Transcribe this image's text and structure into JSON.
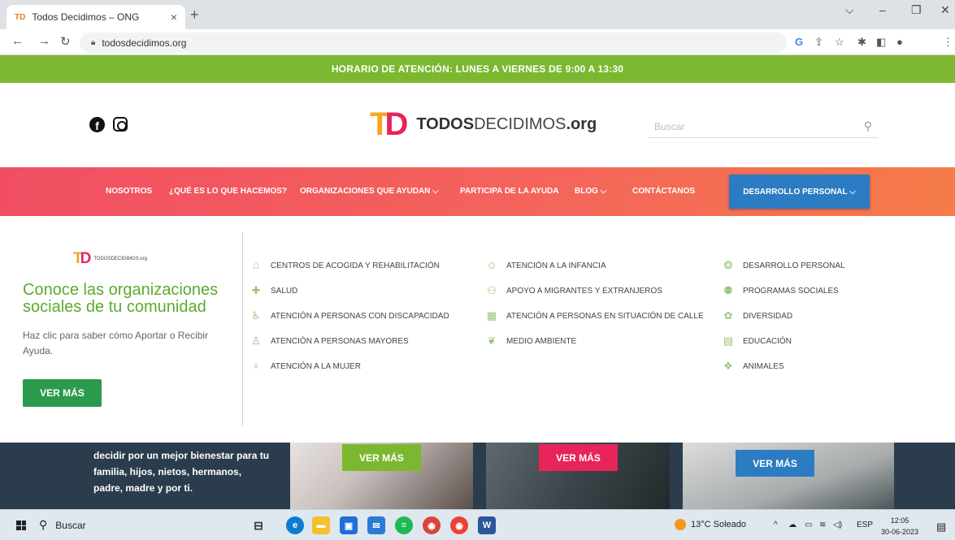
{
  "browser": {
    "tab_title": "Todos Decidimos – ONG",
    "tab_favicon": "TD",
    "url": "todosdecidimos.org",
    "nav_icons": [
      "back-icon",
      "forward-icon",
      "reload-icon"
    ]
  },
  "site": {
    "hours_bar": "HORARIO DE ATENCIÓN: LUNES A VIERNES DE 9:00 A 13:30",
    "logo_bold": "TODOS",
    "logo_light": "DECIDIMOS",
    "logo_suffix": ".org",
    "search_placeholder": "Buscar",
    "nav": [
      {
        "label": "NOSOTROS"
      },
      {
        "label": "¿QUÉ ES LO QUE HACEMOS?"
      },
      {
        "label": "ORGANIZACIONES QUE AYUDAN ⌵"
      },
      {
        "label": "PARTICIPA DE LA AYUDA"
      },
      {
        "label": "BLOG ⌵"
      },
      {
        "label": "CONTÁCTANOS"
      }
    ],
    "nav_highlight": "DESARROLLO PERSONAL ⌵"
  },
  "mega_menu": {
    "logo_small": "TODOSDECIDIMOS.org",
    "heading": "Conoce las organizaciones sociales de tu comunidad",
    "description": "Haz clic para saber cómo Aportar o Recibir Ayuda.",
    "button": "VER MÁS",
    "col1": [
      "CENTROS DE ACOGIDA Y REHABILITACIÓN",
      "SALUD",
      "ATENCIÓN A PERSONAS CON DISCAPACIDAD",
      "ATENCIÓN A PERSONAS MAYORES",
      "ATENCIÓN A LA MUJER"
    ],
    "col2": [
      "ATENCIÓN A LA INFANCIA",
      "APOYO A MIGRANTES Y EXTRANJEROS",
      "ATENCIÓN A PERSONAS EN SITUACIÓN DE CALLE",
      "MEDIO AMBIENTE"
    ],
    "col3": [
      "DESARROLLO PERSONAL",
      "PROGRAMAS SOCIALES",
      "DIVERSIDAD",
      "EDUCACIÓN",
      "ANIMALES"
    ]
  },
  "banner": {
    "text": "decidir por un mejor bienestar para tu familia, hijos, nietos, hermanos, padre, madre y por ti.",
    "btn1": "VER MÁS",
    "btn2": "VER MÁS",
    "btn3": "VER MÁS",
    "btn1_color": "#7cb82f",
    "btn2_color": "#e8245a",
    "btn3_color": "#2b7cc3"
  },
  "taskbar": {
    "search": "Buscar",
    "weather": "13°C  Soleado",
    "lang": "ESP",
    "time": "12:05",
    "date": "30-06-2023"
  }
}
